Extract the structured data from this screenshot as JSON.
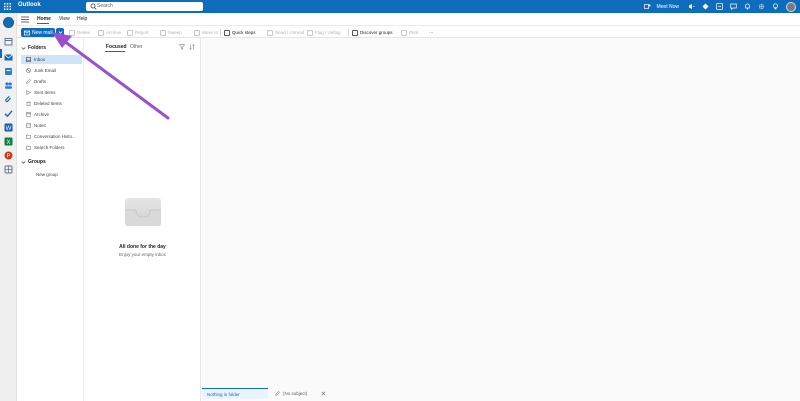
{
  "titlebar": {
    "app_name": "Outlook",
    "search_placeholder": "Search",
    "meet_now": "Meet Now",
    "icons": [
      "teams-icon",
      "megaphone-icon",
      "diamond-icon",
      "translate-icon",
      "chat-icon",
      "bell-icon",
      "gear-icon",
      "lightbulb-icon"
    ]
  },
  "menu": {
    "tabs": [
      "Home",
      "View",
      "Help"
    ],
    "active_tab": "Home"
  },
  "ribbon": {
    "new_mail": "New mail",
    "buttons": [
      "Delete",
      "Archive",
      "Report",
      "Sweep",
      "Move to",
      "Quick steps",
      "Read / Unread",
      "Flag / Unflag",
      "Discover groups",
      "Print"
    ],
    "enabled": [
      "Quick steps",
      "Discover groups"
    ]
  },
  "folders": {
    "section_label": "Folders",
    "items": [
      "Inbox",
      "Junk Email",
      "Drafts",
      "Sent Items",
      "Deleted Items",
      "Archive",
      "Notes",
      "Conversation Histo...",
      "Search Folders"
    ],
    "selected": "Inbox",
    "groups_label": "Groups",
    "new_group": "New group"
  },
  "message_list": {
    "tabs": [
      "Focused",
      "Other"
    ],
    "active_tab": "Focused",
    "empty_title": "All done for the day",
    "empty_subtitle": "Enjoy your empty inbox"
  },
  "bottom_bar": {
    "active_label": "Nothing in folder",
    "draft_label": "(No subject)"
  },
  "colors": {
    "brand": "#0f6cbd",
    "selected_folder": "#cfe4fa",
    "annotation_arrow": "#9b4fd0"
  }
}
